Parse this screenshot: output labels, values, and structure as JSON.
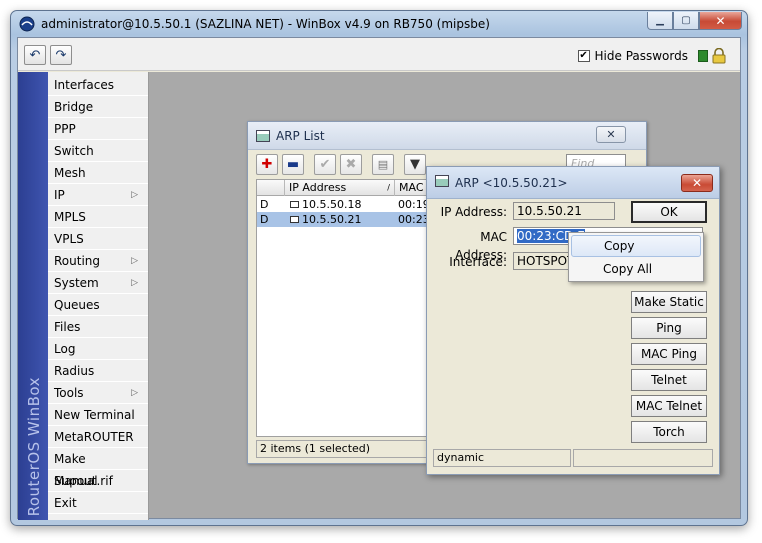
{
  "window": {
    "title": "administrator@10.5.50.1 (SAZLINA NET) - WinBox v4.9 on RB750 (mipsbe)"
  },
  "toolbar": {
    "undo_icon": "undo-icon",
    "redo_icon": "redo-icon",
    "hide_passwords_label": "Hide Passwords",
    "hide_passwords_checked": true
  },
  "sidebar": {
    "brand": "RouterOS WinBox",
    "items": [
      {
        "label": "Interfaces",
        "submenu": false
      },
      {
        "label": "Bridge",
        "submenu": false
      },
      {
        "label": "PPP",
        "submenu": false
      },
      {
        "label": "Switch",
        "submenu": false
      },
      {
        "label": "Mesh",
        "submenu": false
      },
      {
        "label": "IP",
        "submenu": true
      },
      {
        "label": "MPLS",
        "submenu": false
      },
      {
        "label": "VPLS",
        "submenu": false
      },
      {
        "label": "Routing",
        "submenu": true
      },
      {
        "label": "System",
        "submenu": true
      },
      {
        "label": "Queues",
        "submenu": false
      },
      {
        "label": "Files",
        "submenu": false
      },
      {
        "label": "Log",
        "submenu": false
      },
      {
        "label": "Radius",
        "submenu": false
      },
      {
        "label": "Tools",
        "submenu": true
      },
      {
        "label": "New Terminal",
        "submenu": false
      },
      {
        "label": "MetaROUTER",
        "submenu": false
      },
      {
        "label": "Make Supout.rif",
        "submenu": false
      },
      {
        "label": "Manual",
        "submenu": false
      },
      {
        "label": "Exit",
        "submenu": false
      }
    ]
  },
  "arp_list": {
    "title": "ARP List",
    "find_placeholder": "Find",
    "columns": [
      "",
      "IP Address",
      "MAC A"
    ],
    "rows": [
      {
        "flag": "D",
        "ip": "10.5.50.18",
        "mac": "00:19:",
        "selected": false
      },
      {
        "flag": "D",
        "ip": "10.5.50.21",
        "mac": "00:23:",
        "selected": true
      }
    ],
    "status": "2 items (1 selected)"
  },
  "arp_dialog": {
    "title": "ARP <10.5.50.21>",
    "fields": {
      "ip_label": "IP Address:",
      "ip_value": "10.5.50.21",
      "mac_label": "MAC Address:",
      "mac_value": "00:23:CD:E",
      "interface_label": "Interface:",
      "interface_value": "HOTSPOT"
    },
    "buttons": {
      "ok": "OK",
      "make_static": "Make Static",
      "ping": "Ping",
      "mac_ping": "MAC Ping",
      "telnet": "Telnet",
      "mac_telnet": "MAC Telnet",
      "torch": "Torch"
    },
    "status_left": "dynamic",
    "status_right": ""
  },
  "context_menu": {
    "items": [
      "Copy",
      "Copy All"
    ]
  },
  "colors": {
    "brand_bar": "#2c3f92",
    "selection": "#a8c3e6",
    "text_highlight": "#316ac5",
    "close_red": "#c74a35"
  }
}
